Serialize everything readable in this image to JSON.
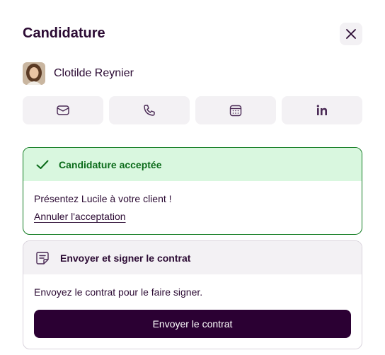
{
  "header": {
    "title": "Candidature"
  },
  "candidate": {
    "name": "Clotilde Reynier"
  },
  "actions": [
    {
      "icon": "mail-icon"
    },
    {
      "icon": "phone-icon"
    },
    {
      "icon": "calendar-icon"
    },
    {
      "icon": "linkedin-icon"
    }
  ],
  "accepted_card": {
    "title": "Candidature acceptée",
    "message": "Présentez Lucile à votre client !",
    "cancel_link": "Annuler l'acceptation"
  },
  "contract_card": {
    "title": "Envoyer et signer le contrat",
    "message": "Envoyez le contrat pour le faire signer.",
    "button_label": "Envoyer le contrat"
  },
  "colors": {
    "brand_dark": "#2b0033",
    "success_green": "#0b6b1a",
    "success_bg": "#d9f7df",
    "neutral_bg": "#f3f1f4"
  }
}
